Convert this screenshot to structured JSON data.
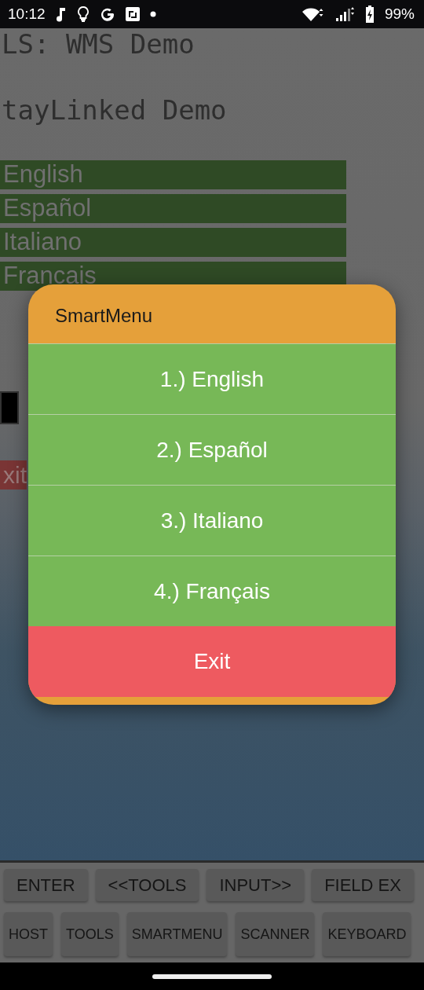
{
  "status_bar": {
    "time": "10:12",
    "battery": "99%"
  },
  "terminal": {
    "lines": [
      "LS: WMS Demo",
      "tayLinked Demo"
    ]
  },
  "language_bars": [
    "English",
    "Español",
    "Italiano",
    "Francais"
  ],
  "exit_partial": "xit",
  "dialog": {
    "title": "SmartMenu",
    "items": [
      {
        "label": "1.) English",
        "kind": "option"
      },
      {
        "label": "2.) Español",
        "kind": "option"
      },
      {
        "label": "3.) Italiano",
        "kind": "option"
      },
      {
        "label": "4.) Français",
        "kind": "option"
      },
      {
        "label": "Exit",
        "kind": "exit"
      }
    ]
  },
  "toolbar": {
    "row_1": [
      "ENTER",
      "<<TOOLS",
      "INPUT>>",
      "FIELD EX"
    ],
    "row_2": [
      "HOST",
      "TOOLS",
      "SMARTMENU",
      "SCANNER",
      "KEYBOARD"
    ]
  }
}
